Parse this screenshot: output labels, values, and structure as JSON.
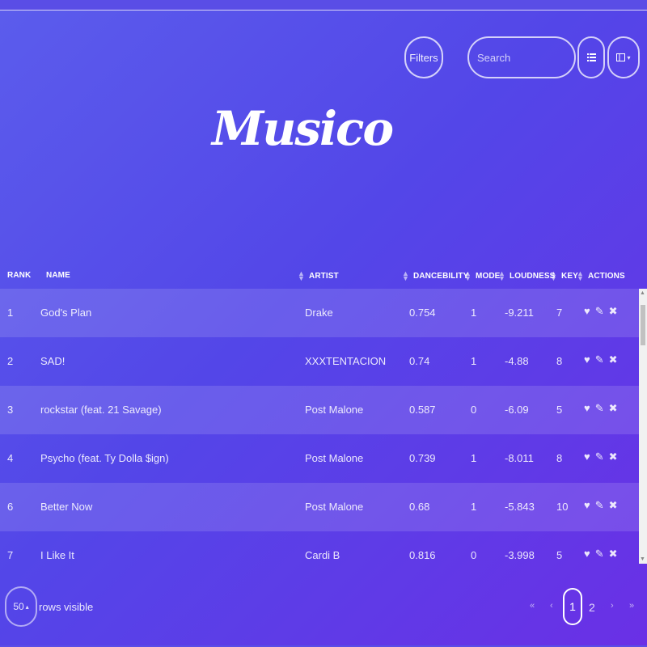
{
  "header": {
    "filters_label": "Filters",
    "search_placeholder": "Search",
    "list_view_icon": "list-icon",
    "column_view_icon": "columns-icon",
    "column_view_caret": "▾",
    "logo_text": "Musico"
  },
  "table": {
    "columns": {
      "rank": "RANK",
      "name": "NAME",
      "artist": "ARTIST",
      "danceability": "DANCEBILITY",
      "mode": "MODE",
      "loudness": "LOUDNESS",
      "key": "KEY",
      "actions": "ACTIONS"
    },
    "rows": [
      {
        "rank": "1",
        "name": "God's Plan",
        "artist": "Drake",
        "danceability": "0.754",
        "mode": "1",
        "loudness": "-9.211",
        "key": "7"
      },
      {
        "rank": "2",
        "name": "SAD!",
        "artist": "XXXTENTACION",
        "danceability": "0.74",
        "mode": "1",
        "loudness": "-4.88",
        "key": "8"
      },
      {
        "rank": "3",
        "name": "rockstar (feat. 21 Savage)",
        "artist": "Post Malone",
        "danceability": "0.587",
        "mode": "0",
        "loudness": "-6.09",
        "key": "5"
      },
      {
        "rank": "4",
        "name": "Psycho (feat. Ty Dolla $ign)",
        "artist": "Post Malone",
        "danceability": "0.739",
        "mode": "1",
        "loudness": "-8.011",
        "key": "8"
      },
      {
        "rank": "6",
        "name": "Better Now",
        "artist": "Post Malone",
        "danceability": "0.68",
        "mode": "1",
        "loudness": "-5.843",
        "key": "10"
      },
      {
        "rank": "7",
        "name": "I Like It",
        "artist": "Cardi B",
        "danceability": "0.816",
        "mode": "0",
        "loudness": "-3.998",
        "key": "5"
      }
    ],
    "action_icons": {
      "like": "♥",
      "edit": "✎",
      "delete": "✖"
    }
  },
  "footer": {
    "rows_visible_value": "50",
    "rows_visible_caret": "▴",
    "rows_visible_label": "rows visible",
    "pager": {
      "first": "«",
      "prev": "‹",
      "pages": [
        "1",
        "2"
      ],
      "current_page": "1",
      "next": "›",
      "last": "»"
    }
  },
  "colors": {
    "gradient_start": "#5b5cec",
    "gradient_end": "#6a30e6",
    "row_highlight": "rgba(255,255,255,0.13)"
  }
}
